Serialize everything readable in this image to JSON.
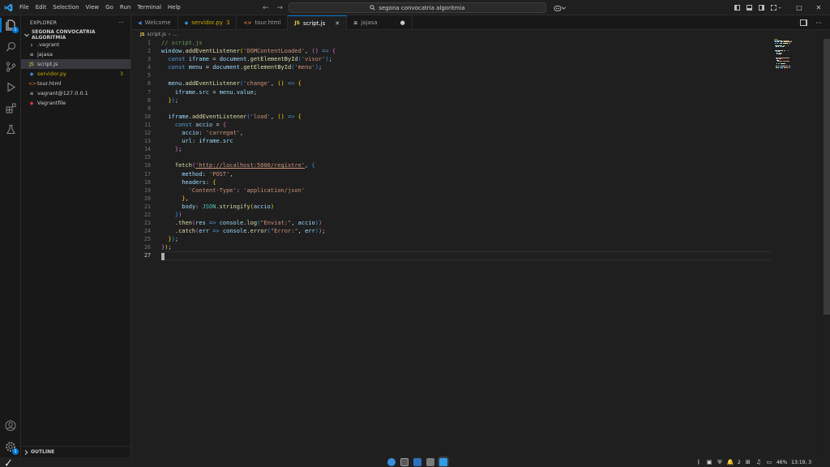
{
  "titlebar": {
    "menu": [
      "File",
      "Edit",
      "Selection",
      "View",
      "Go",
      "Run",
      "Terminal",
      "Help"
    ],
    "back_arrow": "←",
    "forward_arrow": "→",
    "search_text": "segona convocatria algoritmia",
    "win_min": "–",
    "win_max": "□",
    "win_close": "✕"
  },
  "activity": {
    "explorer_badge": "1",
    "settings_badge": "1"
  },
  "sidebar": {
    "title": "EXPLORER",
    "more": "···",
    "root": "SEGONA CONVOCATRIA ALGORITMIA",
    "items": [
      {
        "label": ".vagrant",
        "icon": "›",
        "color": "#cccccc",
        "count": ""
      },
      {
        "label": "jajasa",
        "icon": "≡",
        "color": "#cccccc",
        "count": ""
      },
      {
        "label": "script.js",
        "icon": "JS",
        "color": "#e8d44d",
        "count": ""
      },
      {
        "label": "servidor.py",
        "icon": "◆",
        "color": "#3b8ed9",
        "count": "3"
      },
      {
        "label": "tour.html",
        "icon": "<>",
        "color": "#e37933",
        "count": ""
      },
      {
        "label": "vagrant@127.0.0.1",
        "icon": "≡",
        "color": "#cccccc",
        "count": ""
      },
      {
        "label": "Vagrantfile",
        "icon": "◆",
        "color": "#d8383f",
        "count": ""
      }
    ],
    "outline": "OUTLINE"
  },
  "tabs": [
    {
      "label": "Welcome",
      "icon": "◀",
      "icon_color": "#3b8ed9",
      "extra": "",
      "active": false
    },
    {
      "label": "servidor.py",
      "icon": "◆",
      "icon_color": "#3b8ed9",
      "extra": "3",
      "active": false
    },
    {
      "label": "tour.html",
      "icon": "<>",
      "icon_color": "#e37933",
      "extra": "",
      "active": false
    },
    {
      "label": "script.js",
      "icon": "JS",
      "icon_color": "#e8d44d",
      "extra": "✕",
      "active": true
    },
    {
      "label": "jajasa",
      "icon": "≡",
      "icon_color": "#cccccc",
      "extra": "●",
      "active": false
    }
  ],
  "breadcrumb": {
    "icon": "JS",
    "file": "script.js",
    "sep": "›",
    "rest": "..."
  },
  "editor": {
    "current_line": 27,
    "lines": [
      [
        [
          "cm",
          "// script.js"
        ]
      ],
      [
        [
          "var",
          "window"
        ],
        [
          "pn",
          "."
        ],
        [
          "fn",
          "addEventListener"
        ],
        [
          "br1",
          "("
        ],
        [
          "str",
          "'DOMContentLoaded'"
        ],
        [
          "pn",
          ", "
        ],
        [
          "br2",
          "("
        ],
        [
          "br2",
          ")"
        ],
        [
          "pn",
          " "
        ],
        [
          "kw",
          "=>"
        ],
        [
          "pn",
          " "
        ],
        [
          "br2",
          "{"
        ]
      ],
      [
        [
          "pn",
          "  "
        ],
        [
          "kw",
          "const"
        ],
        [
          "pn",
          " "
        ],
        [
          "var",
          "iframe"
        ],
        [
          "pn",
          " = "
        ],
        [
          "var",
          "document"
        ],
        [
          "pn",
          "."
        ],
        [
          "fn",
          "getElementById"
        ],
        [
          "br3",
          "("
        ],
        [
          "str",
          "'visor'"
        ],
        [
          "br3",
          ")"
        ],
        [
          "pn",
          ";"
        ]
      ],
      [
        [
          "pn",
          "  "
        ],
        [
          "kw",
          "const"
        ],
        [
          "pn",
          " "
        ],
        [
          "var",
          "menu"
        ],
        [
          "pn",
          " = "
        ],
        [
          "var",
          "document"
        ],
        [
          "pn",
          "."
        ],
        [
          "fn",
          "getElementById"
        ],
        [
          "br3",
          "("
        ],
        [
          "str",
          "'menu'"
        ],
        [
          "br3",
          ")"
        ],
        [
          "pn",
          ";"
        ]
      ],
      [],
      [
        [
          "pn",
          "  "
        ],
        [
          "var",
          "menu"
        ],
        [
          "pn",
          "."
        ],
        [
          "fn",
          "addEventListener"
        ],
        [
          "br3",
          "("
        ],
        [
          "str",
          "'change'"
        ],
        [
          "pn",
          ", "
        ],
        [
          "br1",
          "("
        ],
        [
          "br1",
          ")"
        ],
        [
          "pn",
          " "
        ],
        [
          "kw",
          "=>"
        ],
        [
          "pn",
          " "
        ],
        [
          "br1",
          "{"
        ]
      ],
      [
        [
          "pn",
          "    "
        ],
        [
          "var",
          "iframe"
        ],
        [
          "pn",
          "."
        ],
        [
          "var",
          "src"
        ],
        [
          "pn",
          " = "
        ],
        [
          "var",
          "menu"
        ],
        [
          "pn",
          "."
        ],
        [
          "var",
          "value"
        ],
        [
          "pn",
          ";"
        ]
      ],
      [
        [
          "pn",
          "  "
        ],
        [
          "br1",
          "}"
        ],
        [
          "br3",
          ")"
        ],
        [
          "pn",
          ";"
        ]
      ],
      [],
      [
        [
          "pn",
          "  "
        ],
        [
          "var",
          "iframe"
        ],
        [
          "pn",
          "."
        ],
        [
          "fn",
          "addEventListener"
        ],
        [
          "br3",
          "("
        ],
        [
          "str",
          "'load'"
        ],
        [
          "pn",
          ", "
        ],
        [
          "br1",
          "("
        ],
        [
          "br1",
          ")"
        ],
        [
          "pn",
          " "
        ],
        [
          "kw",
          "=>"
        ],
        [
          "pn",
          " "
        ],
        [
          "br1",
          "{"
        ]
      ],
      [
        [
          "pn",
          "    "
        ],
        [
          "kw",
          "const"
        ],
        [
          "pn",
          " "
        ],
        [
          "var",
          "accio"
        ],
        [
          "pn",
          " = "
        ],
        [
          "br2",
          "{"
        ]
      ],
      [
        [
          "pn",
          "      "
        ],
        [
          "var",
          "accio"
        ],
        [
          "pn",
          ": "
        ],
        [
          "str",
          "'carregat'"
        ],
        [
          "pn",
          ","
        ]
      ],
      [
        [
          "pn",
          "      "
        ],
        [
          "var",
          "url"
        ],
        [
          "pn",
          ": "
        ],
        [
          "var",
          "iframe"
        ],
        [
          "pn",
          "."
        ],
        [
          "var",
          "src"
        ]
      ],
      [
        [
          "pn",
          "    "
        ],
        [
          "br2",
          "}"
        ],
        [
          "pn",
          ";"
        ]
      ],
      [],
      [
        [
          "pn",
          "    "
        ],
        [
          "fn",
          "fetch"
        ],
        [
          "br2",
          "("
        ],
        [
          "str-u",
          "'http://localhost:5000/registre'"
        ],
        [
          "pn",
          ", "
        ],
        [
          "br3",
          "{"
        ]
      ],
      [
        [
          "pn",
          "      "
        ],
        [
          "var",
          "method"
        ],
        [
          "pn",
          ": "
        ],
        [
          "str",
          "'POST'"
        ],
        [
          "pn",
          ","
        ]
      ],
      [
        [
          "pn",
          "      "
        ],
        [
          "var",
          "headers"
        ],
        [
          "pn",
          ": "
        ],
        [
          "br1",
          "{"
        ]
      ],
      [
        [
          "pn",
          "        "
        ],
        [
          "str",
          "'Content-Type'"
        ],
        [
          "pn",
          ": "
        ],
        [
          "str",
          "'application/json'"
        ]
      ],
      [
        [
          "pn",
          "      "
        ],
        [
          "br1",
          "}"
        ],
        [
          "pn",
          ","
        ]
      ],
      [
        [
          "pn",
          "      "
        ],
        [
          "var",
          "body"
        ],
        [
          "pn",
          ": "
        ],
        [
          "cls",
          "JSON"
        ],
        [
          "pn",
          "."
        ],
        [
          "fn",
          "stringify"
        ],
        [
          "br1",
          "("
        ],
        [
          "var",
          "accio"
        ],
        [
          "br1",
          ")"
        ]
      ],
      [
        [
          "pn",
          "    "
        ],
        [
          "br3",
          "}"
        ],
        [
          "br2",
          ")"
        ]
      ],
      [
        [
          "pn",
          "    ."
        ],
        [
          "fn",
          "then"
        ],
        [
          "br2",
          "("
        ],
        [
          "var",
          "res"
        ],
        [
          "pn",
          " "
        ],
        [
          "kw",
          "=>"
        ],
        [
          "pn",
          " "
        ],
        [
          "var",
          "console"
        ],
        [
          "pn",
          "."
        ],
        [
          "fn",
          "log"
        ],
        [
          "br3",
          "("
        ],
        [
          "str",
          "\"Enviat:\""
        ],
        [
          "pn",
          ", "
        ],
        [
          "var",
          "accio"
        ],
        [
          "br3",
          ")"
        ],
        [
          "br2",
          ")"
        ]
      ],
      [
        [
          "pn",
          "    ."
        ],
        [
          "fn",
          "catch"
        ],
        [
          "br2",
          "("
        ],
        [
          "var",
          "err"
        ],
        [
          "pn",
          " "
        ],
        [
          "kw",
          "=>"
        ],
        [
          "pn",
          " "
        ],
        [
          "var",
          "console"
        ],
        [
          "pn",
          "."
        ],
        [
          "fn",
          "error"
        ],
        [
          "br3",
          "("
        ],
        [
          "str",
          "\"Error:\""
        ],
        [
          "pn",
          ", "
        ],
        [
          "var",
          "err"
        ],
        [
          "br3",
          ")"
        ],
        [
          "br2",
          ")"
        ],
        [
          "pn",
          ";"
        ]
      ],
      [
        [
          "pn",
          "  "
        ],
        [
          "br1",
          "}"
        ],
        [
          "br3",
          ")"
        ],
        [
          "pn",
          ";"
        ]
      ],
      [
        [
          "br2",
          "}"
        ],
        [
          "br1",
          ")"
        ],
        [
          "pn",
          ";"
        ]
      ],
      []
    ]
  },
  "taskbar": {
    "battery": "46%",
    "clock": "13:19, 3",
    "bell_count": "2"
  },
  "colors": {
    "accent": "#0078d4",
    "warning": "#cca700"
  }
}
